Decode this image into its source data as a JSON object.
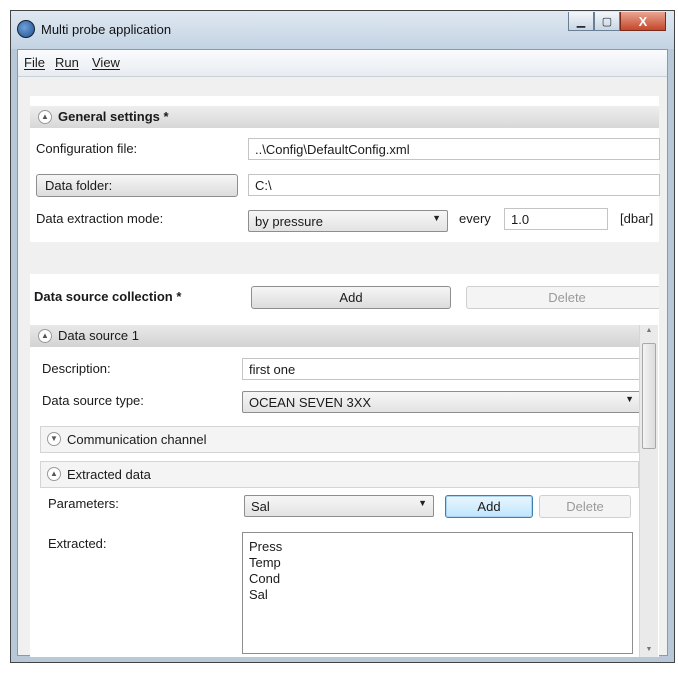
{
  "window": {
    "title": "Multi probe application",
    "controls": {
      "minimize": "▁",
      "maximize": "▢",
      "close": "X"
    }
  },
  "menu": {
    "file": "File",
    "run": "Run",
    "view": "View"
  },
  "general_settings": {
    "header": "General settings *",
    "config_label": "Configuration file:",
    "config_value": "..\\Config\\DefaultConfig.xml",
    "data_folder_button": "Data folder:",
    "data_folder_value": "C:\\",
    "extraction_label": "Data extraction mode:",
    "extraction_mode": "by pressure",
    "every_label": "every",
    "every_value": "1.0",
    "unit": "[dbar]"
  },
  "collection": {
    "title": "Data source collection *",
    "add_button": "Add",
    "delete_button": "Delete"
  },
  "data_source": {
    "header": "Data source 1",
    "description_label": "Description:",
    "description_value": "first one",
    "type_label": "Data source type:",
    "type_value": "OCEAN SEVEN 3XX",
    "comm_header": "Communication channel",
    "extracted_header": "Extracted data",
    "parameters_label": "Parameters:",
    "parameter_selected": "Sal",
    "param_add_button": "Add",
    "param_delete_button": "Delete",
    "extracted_label": "Extracted:",
    "extracted_items": [
      "Press",
      "Temp",
      "Cond",
      "Sal"
    ]
  },
  "icons": {
    "app": "probe-app-icon",
    "expand_collapse": "chevron-up-icon",
    "expand": "chevron-down-icon",
    "dropdown": "dropdown-arrow-icon"
  }
}
